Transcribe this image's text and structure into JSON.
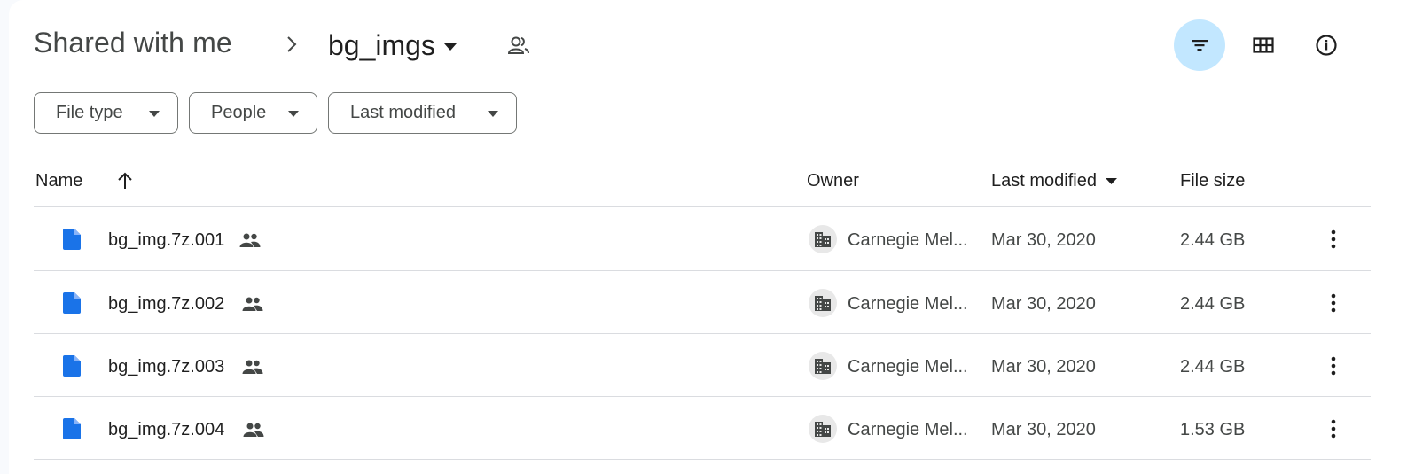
{
  "breadcrumb": {
    "root": "Shared with me",
    "current": "bg_imgs"
  },
  "icons": {
    "separator": "chevron-right-icon",
    "current_dropdown": "caret-down-icon",
    "shared_folder": "shared-people-icon",
    "filter": "filter-icon",
    "grid": "grid-view-icon",
    "info": "info-icon",
    "file": "file-document-icon",
    "row_shared": "people-icon",
    "owner": "building-icon",
    "more": "more-vert-icon"
  },
  "colors": {
    "accent_active": "#c2e7ff",
    "file_icon_blue": "#1a73e8"
  },
  "filters": [
    {
      "label": "File type"
    },
    {
      "label": "People"
    },
    {
      "label": "Last modified"
    }
  ],
  "columns": {
    "name": "Name",
    "owner": "Owner",
    "last_modified": "Last modified",
    "file_size": "File size"
  },
  "files": [
    {
      "name": "bg_img.7z.001",
      "owner": "Carnegie Mel...",
      "modified": "Mar 30, 2020",
      "size": "2.44 GB"
    },
    {
      "name": "bg_img.7z.002",
      "owner": "Carnegie Mel...",
      "modified": "Mar 30, 2020",
      "size": "2.44 GB"
    },
    {
      "name": "bg_img.7z.003",
      "owner": "Carnegie Mel...",
      "modified": "Mar 30, 2020",
      "size": "2.44 GB"
    },
    {
      "name": "bg_img.7z.004",
      "owner": "Carnegie Mel...",
      "modified": "Mar 30, 2020",
      "size": "1.53 GB"
    }
  ]
}
